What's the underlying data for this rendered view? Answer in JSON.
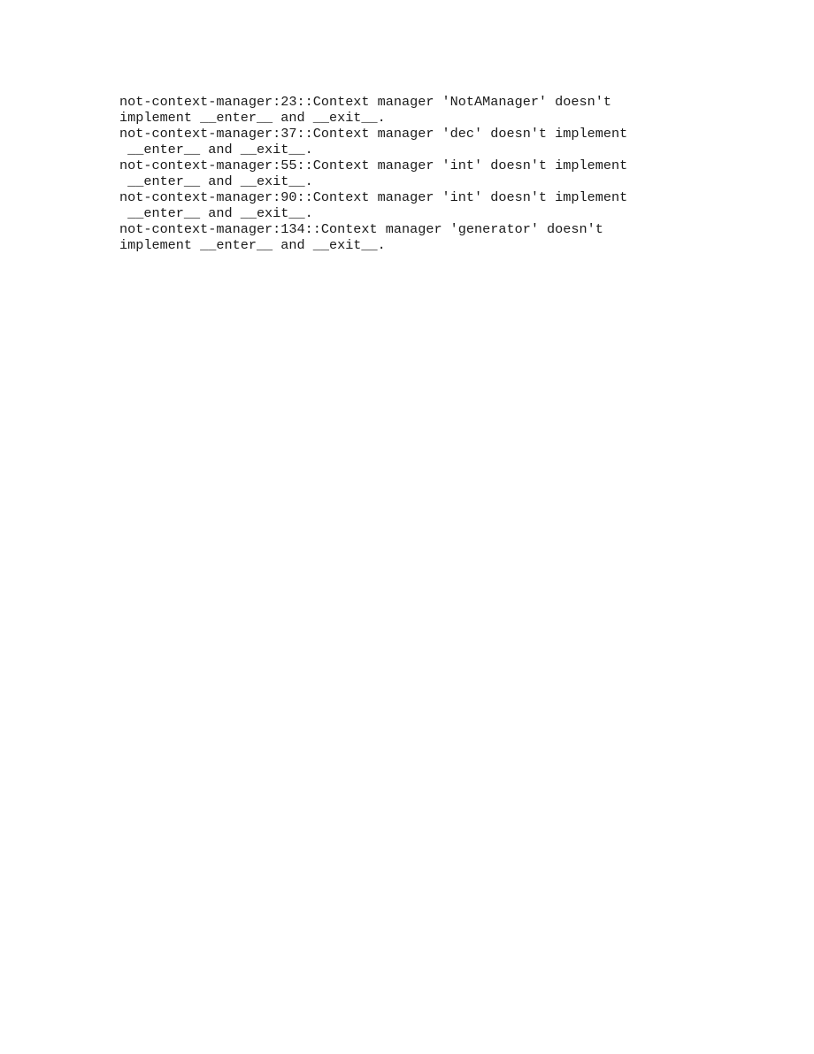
{
  "document": {
    "kind": "lint-report-text-output",
    "background_color": "#ffffff",
    "text_color": "#1a1a1a",
    "checker": "not-context-manager"
  },
  "report": {
    "messages": [
      {
        "id": "msg-1",
        "checker": "not-context-manager",
        "line_number": "23",
        "object": "NotAManager",
        "wrapped_lines": [
          "not-context-manager:23::Context manager 'NotAManager' doesn't",
          "implement __enter__ and __exit__."
        ],
        "full_text": "not-context-manager:23::Context manager 'NotAManager' doesn't implement __enter__ and __exit__."
      },
      {
        "id": "msg-2",
        "checker": "not-context-manager",
        "line_number": "37",
        "object": "dec",
        "wrapped_lines": [
          "not-context-manager:37::Context manager 'dec' doesn't implement",
          " __enter__ and __exit__."
        ],
        "full_text": "not-context-manager:37::Context manager 'dec' doesn't implement __enter__ and __exit__."
      },
      {
        "id": "msg-3",
        "checker": "not-context-manager",
        "line_number": "55",
        "object": "int",
        "wrapped_lines": [
          "not-context-manager:55::Context manager 'int' doesn't implement",
          " __enter__ and __exit__."
        ],
        "full_text": "not-context-manager:55::Context manager 'int' doesn't implement __enter__ and __exit__."
      },
      {
        "id": "msg-4",
        "checker": "not-context-manager",
        "line_number": "90",
        "object": "int",
        "wrapped_lines": [
          "not-context-manager:90::Context manager 'int' doesn't implement",
          " __enter__ and __exit__."
        ],
        "full_text": "not-context-manager:90::Context manager 'int' doesn't implement __enter__ and __exit__."
      },
      {
        "id": "msg-5",
        "checker": "not-context-manager",
        "line_number": "134",
        "object": "generator",
        "wrapped_lines": [
          "not-context-manager:134::Context manager 'generator' doesn't",
          "implement __enter__ and __exit__."
        ],
        "full_text": "not-context-manager:134::Context manager 'generator' doesn't implement __enter__ and __exit__."
      }
    ]
  }
}
